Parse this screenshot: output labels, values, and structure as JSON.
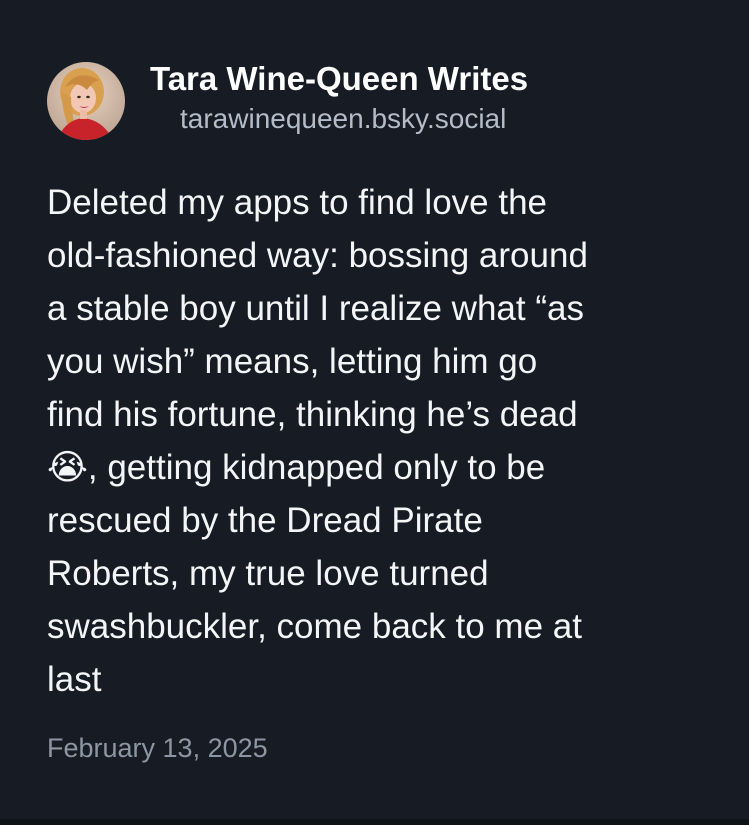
{
  "author": {
    "display_name": "Tara Wine-Queen Writes",
    "handle": "tarawinequeen.bsky.social"
  },
  "post": {
    "lines": [
      "Deleted my apps to find love the",
      "old-fashioned way: bossing around",
      "a stable boy until I realize what “as",
      "you wish” means, letting him go",
      "find his fortune, thinking he’s dead",
      "😭, getting kidnapped only to be",
      "rescued by the Dread Pirate",
      "Roberts, my true love turned",
      "swashbuckler, come back to me at",
      "last"
    ],
    "date": "February 13, 2025"
  },
  "colors": {
    "background": "#171c24",
    "text": "#f4f5f7",
    "handle": "#b3bcc8",
    "date": "#8d96a3"
  },
  "icons": {
    "avatar": "profile-photo",
    "emoji": "loudly-crying-face"
  }
}
